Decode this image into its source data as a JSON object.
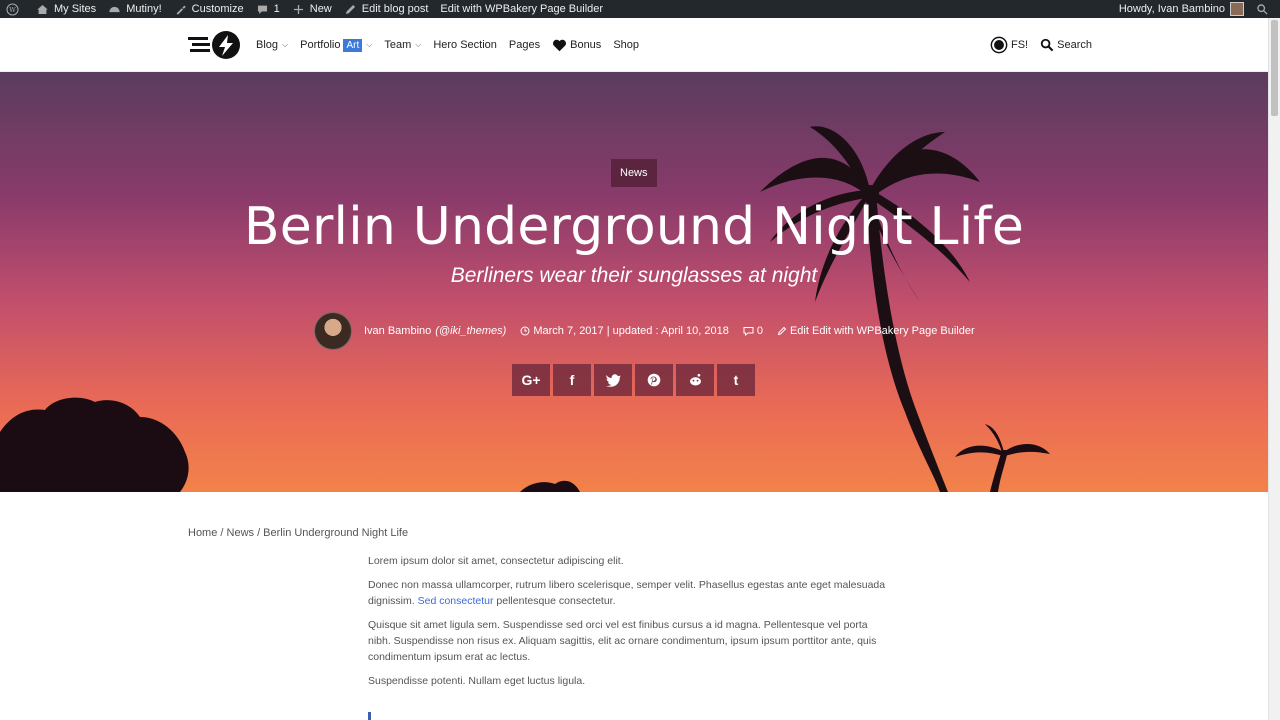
{
  "adminbar": {
    "items": [
      {
        "icon": "wordpress-icon",
        "label": ""
      },
      {
        "icon": "home-icon",
        "label": "My Sites"
      },
      {
        "icon": "dashboard-icon",
        "label": "Mutiny!"
      },
      {
        "icon": "brush-icon",
        "label": "Customize"
      },
      {
        "icon": "comment-icon",
        "label": "1"
      },
      {
        "icon": "plus-icon",
        "label": "New"
      },
      {
        "icon": "pencil-icon",
        "label": "Edit blog post"
      },
      {
        "icon": "",
        "label": "Edit with WPBakery Page Builder"
      }
    ],
    "howdy": "Howdy, Ivan Bambino"
  },
  "nav": {
    "blog": "Blog",
    "portfolio": "Portfolio",
    "art_badge": "Art",
    "team": "Team",
    "hero_section": "Hero Section",
    "pages": "Pages",
    "bonus": "Bonus",
    "shop": "Shop",
    "fs": "FS!",
    "search": "Search"
  },
  "hero": {
    "category": "News",
    "title": "Berlin Underground Night Life",
    "subtitle": "Berliners wear their sunglasses at night",
    "author": "Ivan Bambino",
    "handle": "(@iki_themes)",
    "dates": "March 7, 2017 | updated : April 10, 2018",
    "comments": "0",
    "edit": "Edit Edit with WPBakery Page Builder",
    "share": [
      "G+",
      "f",
      "t",
      "p",
      "r",
      "t"
    ]
  },
  "breadcrumb": "Home / News / Berlin Underground Night Life",
  "article": {
    "p1": "Lorem ipsum dolor sit amet, consectetur adipiscing elit.",
    "p2_a": "Donec non massa ullamcorper, rutrum libero scelerisque, semper velit. Phasellus egestas ante eget malesuada dignissim. ",
    "p2_link": "Sed consectetur",
    "p2_b": " pellentesque consectetur.",
    "p3": "Quisque sit amet ligula sem. Suspendisse sed orci vel est finibus cursus a id magna. Pellentesque vel porta nibh. Suspendisse non risus ex. Aliquam sagittis, elit ac ornare condimentum, ipsum ipsum porttitor ante, quis condimentum ipsum erat ac lectus.",
    "p4": "Suspendisse potenti. Nullam eget luctus ligula."
  },
  "colors": {
    "adminbar": "#23282d",
    "accent": "#3b7ad9",
    "hero_top": "#5a3c5e",
    "hero_bottom": "#f2824a"
  }
}
